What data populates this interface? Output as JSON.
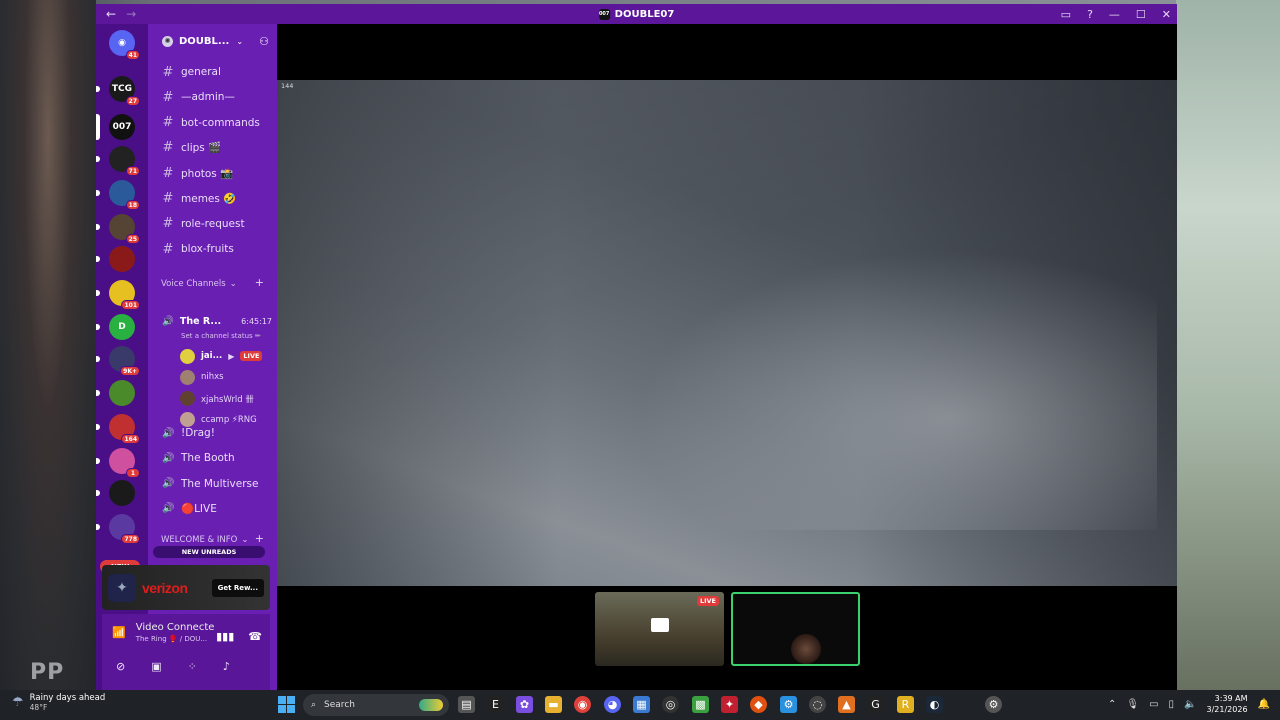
{
  "window": {
    "title": "DOUBLE07",
    "title_mini": "007"
  },
  "rail": {
    "home_badge": "41",
    "servers": [
      {
        "label": "TCG",
        "badge": "27",
        "color": "#1a1a1a"
      },
      {
        "label": "007",
        "badge": "",
        "color": "#111111"
      },
      {
        "label": "",
        "badge": "71",
        "color": "#222222"
      },
      {
        "label": "",
        "badge": "18",
        "color": "#2a5a9a"
      },
      {
        "label": "",
        "badge": "25",
        "color": "#554433"
      },
      {
        "label": "",
        "badge": "",
        "color": "#8a1a1a"
      },
      {
        "label": "",
        "badge": "101",
        "color": "#e6c020"
      },
      {
        "label": "D",
        "badge": "",
        "color": "#28b040"
      },
      {
        "label": "",
        "badge": "9K+",
        "color": "#3a3a6a"
      },
      {
        "label": "",
        "badge": "",
        "color": "#4a8a2a"
      },
      {
        "label": "",
        "badge": "164",
        "color": "#c03030"
      },
      {
        "label": "",
        "badge": "1",
        "color": "#d050a0"
      },
      {
        "label": "",
        "badge": "",
        "color": "#1a1a1a"
      },
      {
        "label": "",
        "badge": "778",
        "color": "#5a3aa0"
      }
    ],
    "new_label": "NEW"
  },
  "sidebar": {
    "server_name": "DOUBL...",
    "text_channels": [
      "general",
      "—admin—",
      "bot-commands",
      "clips 🎬",
      "photos 📸",
      "memes 🤣",
      "role-request",
      "blox-fruits"
    ],
    "voice_category": "Voice Channels",
    "active_voice": {
      "name": "The R...",
      "timer": "6:45:17",
      "status": "Set a channel status ✏"
    },
    "voice_users": [
      {
        "name": "jai...",
        "live": "LIVE"
      },
      {
        "name": "nihxs",
        "live": ""
      },
      {
        "name": "xjahsWrld 卌",
        "live": ""
      },
      {
        "name": "ccamp ⚡RNG",
        "live": ""
      }
    ],
    "voice_channels": [
      "!Drag!",
      "The Booth",
      "The Multiverse",
      "🔴LIVE"
    ],
    "welcome_category": "WELCOME & INFO",
    "new_unreads": "NEW UNREADS"
  },
  "ad": {
    "brand": "verizon",
    "button": "Get Rew..."
  },
  "voice_panel": {
    "title": "Video Connecte",
    "sub": "The Ring 🥊 / DOU..."
  },
  "stage": {
    "fps": "144",
    "thumb_live": "LIVE"
  },
  "taskbar": {
    "weather_line1": "Rainy days ahead",
    "weather_line2": "48°F",
    "search_placeholder": "Search",
    "time": "3:39 AM",
    "date": "3/21/2026"
  }
}
